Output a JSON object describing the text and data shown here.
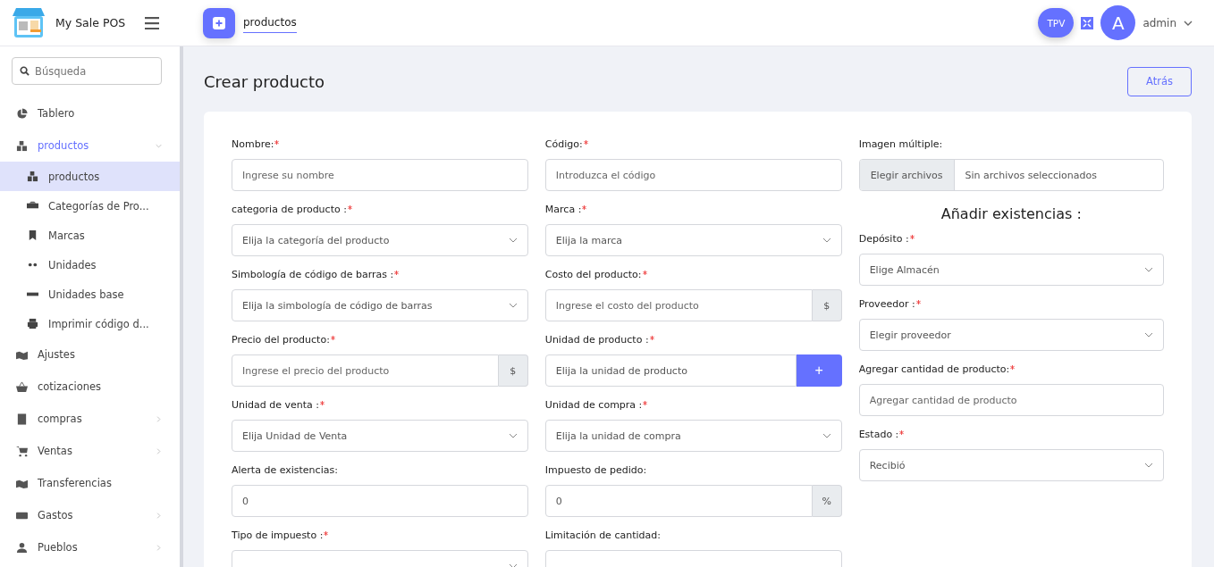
{
  "app": {
    "name": "My Sale POS"
  },
  "topbar": {
    "tab": "productos",
    "pos_button": "TPV",
    "avatar": "A",
    "user": "admin"
  },
  "sidebar": {
    "search": {
      "placeholder": "Búsqueda"
    },
    "items": [
      {
        "label": "Tablero",
        "selected": false
      },
      {
        "label": "productos",
        "selected": true,
        "expanded": true,
        "children": [
          {
            "label": "productos",
            "selected": true
          },
          {
            "label": "Categorías de Pro...",
            "selected": false
          },
          {
            "label": "Marcas",
            "selected": false
          },
          {
            "label": "Unidades",
            "selected": false
          },
          {
            "label": "Unidades base",
            "selected": false
          },
          {
            "label": "Imprimir código d...",
            "selected": false
          }
        ]
      },
      {
        "label": "Ajustes",
        "selected": false
      },
      {
        "label": "cotizaciones",
        "selected": false
      },
      {
        "label": "compras",
        "selected": false,
        "expanded": false
      },
      {
        "label": "Ventas",
        "selected": false,
        "expanded": false
      },
      {
        "label": "Transferencias",
        "selected": false
      },
      {
        "label": "Gastos",
        "selected": false,
        "expanded": false
      },
      {
        "label": "Pueblos",
        "selected": false,
        "expanded": false
      }
    ]
  },
  "page": {
    "title": "Crear producto",
    "back_button": "Atrás"
  },
  "form": {
    "fields": [
      {
        "label": "Nombre:",
        "required": true,
        "kind": "text",
        "placeholder": "Ingrese su nombre"
      },
      {
        "label": "Código:",
        "required": true,
        "kind": "text",
        "placeholder": "Introduzca el código"
      },
      {
        "label": "categoria de producto :",
        "required": true,
        "kind": "select",
        "value": "Elija la categoría del producto"
      },
      {
        "label": "Marca :",
        "required": true,
        "kind": "select",
        "value": "Elija la marca"
      },
      {
        "label": "Simbología de código de barras :",
        "required": true,
        "kind": "select",
        "value": "Elija la simbología de código de barras"
      },
      {
        "label": "Costo del producto:",
        "required": true,
        "kind": "addon",
        "placeholder": "Ingrese el costo del producto",
        "addon": "$"
      },
      {
        "label": "Precio del producto:",
        "required": true,
        "kind": "addon",
        "placeholder": "Ingrese el precio del producto",
        "addon": "$"
      },
      {
        "label": "Unidad de producto :",
        "required": true,
        "kind": "button",
        "value": "Elija la unidad de producto",
        "button": "+"
      },
      {
        "label": "Unidad de venta :",
        "required": true,
        "kind": "select",
        "value": "Elija Unidad de Venta"
      },
      {
        "label": "Unidad de compra :",
        "required": true,
        "kind": "select",
        "value": "Elija la unidad de compra"
      },
      {
        "label": "Alerta de existencias:",
        "required": false,
        "kind": "text",
        "value": "0"
      },
      {
        "label": "Impuesto de pedido:",
        "required": false,
        "kind": "addon",
        "value": "0",
        "addon": "%"
      },
      {
        "label": "Tipo de impuesto :",
        "required": true,
        "kind": "select"
      },
      {
        "label": "Limitación de cantidad:",
        "required": false,
        "kind": "text"
      }
    ],
    "images": {
      "label": "Imagen múltiple:",
      "button": "Elegir archivos",
      "status": "Sin archivos seleccionados"
    },
    "stock_heading": "Añadir existencias :",
    "stock_fields": [
      {
        "label": "Depósito :",
        "required": true,
        "kind": "select",
        "value": "Elige Almacén"
      },
      {
        "label": "Proveedor :",
        "required": true,
        "kind": "select",
        "value": "Elegir proveedor"
      },
      {
        "label": "Agregar cantidad de producto:",
        "required": true,
        "kind": "text",
        "placeholder": "Agregar cantidad de producto"
      },
      {
        "label": "Estado :",
        "required": true,
        "kind": "select",
        "value": "Recibió"
      }
    ]
  }
}
